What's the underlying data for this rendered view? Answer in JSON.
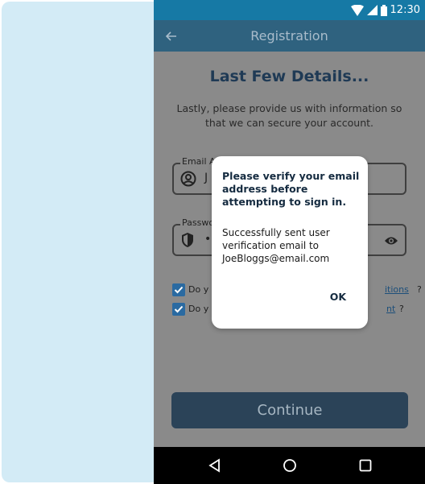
{
  "status_bar": {
    "time": "12:30"
  },
  "app_bar": {
    "title": "Registration"
  },
  "page": {
    "heading": "Last Few Details...",
    "subtitle": "Lastly, please provide us with information so that we can secure your account."
  },
  "email_field": {
    "label": "Email A",
    "value": "J"
  },
  "password_field": {
    "label": "Passwo",
    "value": "•"
  },
  "checkboxes": [
    {
      "prefix": "Do y",
      "link_text": "itions",
      "suffix": "?",
      "checked": true
    },
    {
      "prefix": "Do y",
      "link_text": "nt",
      "suffix": "?",
      "checked": true
    }
  ],
  "continue_button": {
    "label": "Continue"
  },
  "dialog": {
    "title": "Please verify your email address before attempting to sign in.",
    "message": "Successfully sent user verification email to JoeBloggs@email.com",
    "ok_label": "OK"
  },
  "icons": {
    "back": "arrow-back-icon",
    "wifi": "wifi-icon",
    "signal": "signal-icon",
    "battery": "battery-icon",
    "user": "account-circle-icon",
    "shield": "shield-icon",
    "eye": "eye-icon",
    "nav_back": "triangle-back-icon",
    "nav_home": "circle-home-icon",
    "nav_recents": "square-recents-icon"
  },
  "colors": {
    "status_bar": "#1679a5",
    "app_bar": "#2f627f",
    "overlay": "#8a8a8a",
    "button": "#2b4358",
    "left_panel": "#d3ebf6",
    "checkbox": "#2a6aa1"
  }
}
